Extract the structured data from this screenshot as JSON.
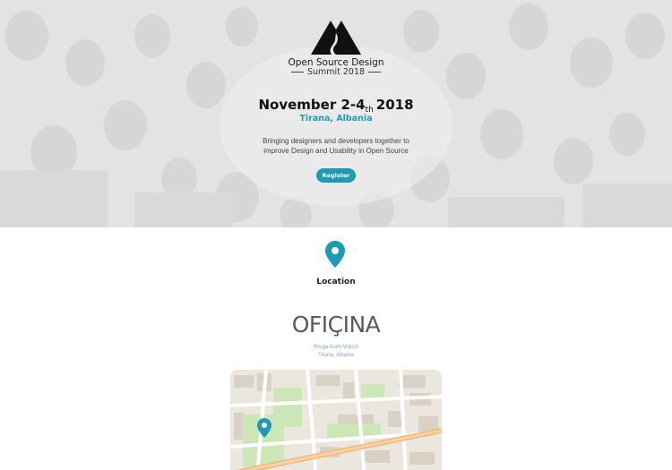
{
  "hero": {
    "logo": {
      "title": "Open Source Design",
      "subtitle": "Summit 2018"
    },
    "date": {
      "main": "November 2-4",
      "suffix": "th",
      "year": "2018"
    },
    "city": "Tirana, Albania",
    "tagline": {
      "line1": "Bringing designers and developers together to",
      "line2": "improve Design and Usability in Open Source"
    },
    "register_label": "Register"
  },
  "location": {
    "heading": "Location",
    "venue_name": "OFIÇINA",
    "address_line1": "Rruga Asim Vokshi",
    "address_line2": "Tirana, Albania"
  },
  "colors": {
    "accent": "#1d9bb5",
    "hero_bg": "#e4e4e4",
    "address": "#8aa5c4"
  }
}
